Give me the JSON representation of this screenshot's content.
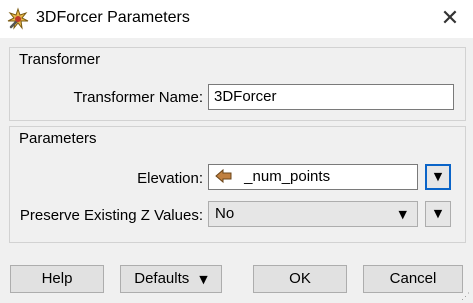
{
  "window": {
    "title": "3DForcer Parameters",
    "icon": "fme-transformer-icon",
    "close_glyph": "✕"
  },
  "transformer_group": {
    "title": "Transformer",
    "name_label": "Transformer Name:",
    "name_value": "3DForcer"
  },
  "parameters_group": {
    "title": "Parameters",
    "elevation_label": "Elevation:",
    "elevation_value": "_num_points",
    "elevation_icon": "attribute-icon",
    "preserve_label": "Preserve Existing Z Values:",
    "preserve_value": "No"
  },
  "buttons": {
    "help": "Help",
    "defaults": "Defaults",
    "ok": "OK",
    "cancel": "Cancel"
  },
  "colors": {
    "focus_blue": "#0a64c8",
    "attribute_icon": "#c08040"
  }
}
